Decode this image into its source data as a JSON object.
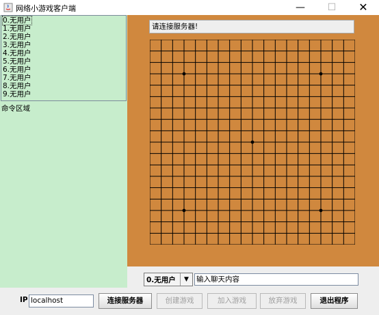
{
  "window": {
    "title": "网络小游戏客户端",
    "min_symbol": "—",
    "max_symbol": "☐",
    "close_symbol": "✕"
  },
  "users": [
    "0.无用户",
    "1.无用户",
    "2.无用户",
    "3.无用户",
    "4.无用户",
    "5.无用户",
    "6.无用户",
    "7.无用户",
    "8.无用户",
    "9.无用户"
  ],
  "command_area_label": "命令区域",
  "status_text": "请连接服务器!",
  "board": {
    "size": 19,
    "star_points": [
      [
        3,
        3
      ],
      [
        15,
        3
      ],
      [
        9,
        9
      ],
      [
        3,
        15
      ],
      [
        15,
        15
      ]
    ]
  },
  "chat": {
    "selected_user": "0.无用户",
    "dropdown_arrow": "▼",
    "input_value": "输入聊天内容"
  },
  "toolbar": {
    "ip_label": "IP",
    "ip_value": "localhost",
    "connect_label": "连接服务器",
    "create_label": "创建游戏",
    "join_label": "加入游戏",
    "giveup_label": "放弃游戏",
    "exit_label": "退出程序"
  },
  "colors": {
    "panel_green": "#c7edcc",
    "board_orange": "#d0883e",
    "grid_line": "#000000"
  }
}
